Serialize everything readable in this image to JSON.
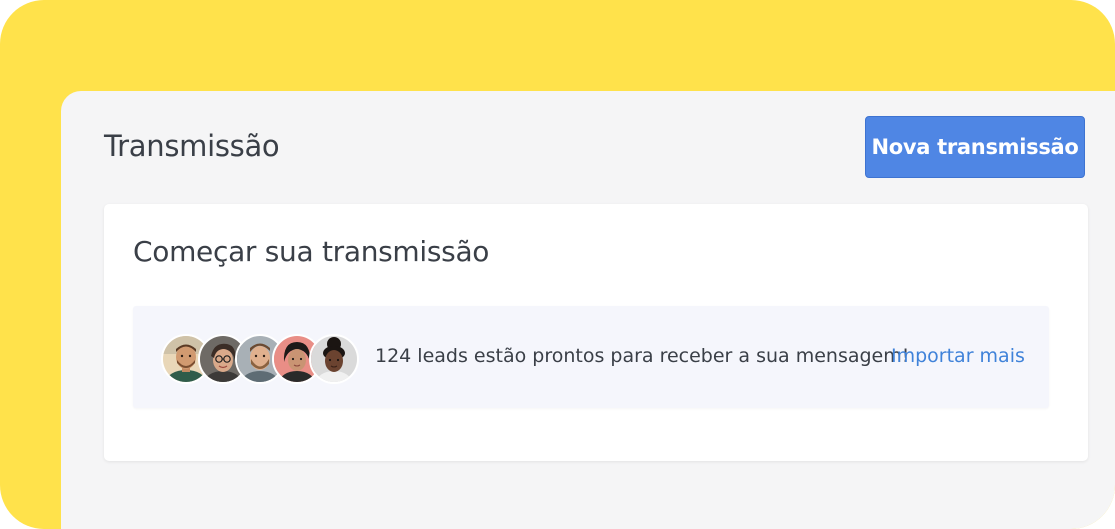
{
  "header": {
    "title": "Transmissão",
    "new_button_label": "Nova transmissão"
  },
  "card": {
    "title": "Começar sua transmissão",
    "leads_message": "124 leads estão prontos para receber a sua mensagem!",
    "import_link": "Importar mais"
  },
  "avatars": [
    {
      "name": "avatar-1",
      "bg": "#E9D7B8"
    },
    {
      "name": "avatar-2",
      "bg": "#6E6A65"
    },
    {
      "name": "avatar-3",
      "bg": "#A8B0B6"
    },
    {
      "name": "avatar-4",
      "bg": "#E98E86"
    },
    {
      "name": "avatar-5",
      "bg": "#DADADA"
    }
  ],
  "colors": {
    "frame": "#FFE24B",
    "panel": "#F5F5F6",
    "primary_button": "#4F86E4",
    "link": "#3F82D9",
    "leads_box": "#F5F6FC"
  }
}
